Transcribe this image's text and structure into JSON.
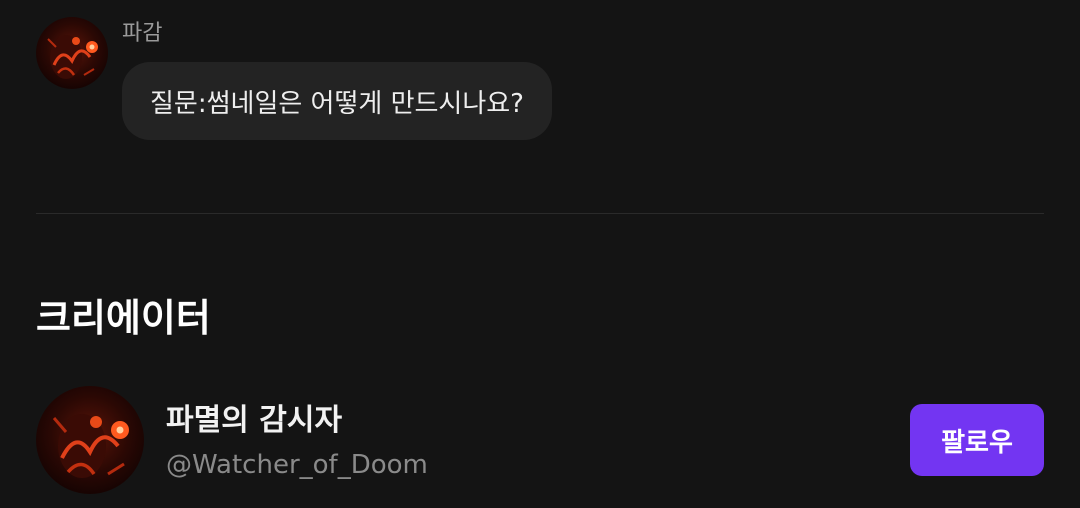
{
  "comment": {
    "author": "파감",
    "text": "질문:썸네일은 어떻게 만드시나요?"
  },
  "section": {
    "heading": "크리에이터"
  },
  "creator": {
    "name": "파멸의 감시자",
    "handle": "@Watcher_of_Doom",
    "follow_label": "팔로우"
  },
  "colors": {
    "background": "#141414",
    "bubble": "#232323",
    "accent": "#7335f2",
    "muted_text": "#8a8a8a"
  },
  "icons": {
    "comment_avatar": "avatar-image",
    "creator_avatar": "avatar-image"
  }
}
